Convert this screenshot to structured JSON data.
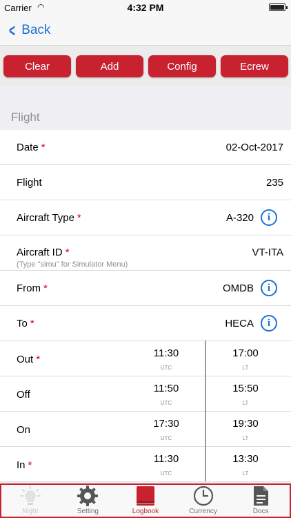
{
  "status": {
    "carrier": "Carrier",
    "time": "4:32 PM"
  },
  "nav": {
    "back_label": "Back"
  },
  "toolbar": {
    "clear": "Clear",
    "add": "Add",
    "config": "Config",
    "ecrew": "Ecrew"
  },
  "section": {
    "title": "Flight"
  },
  "fields": {
    "date": {
      "label": "Date",
      "value": "02-Oct-2017"
    },
    "flight": {
      "label": "Flight",
      "value": "235"
    },
    "aircraft_type": {
      "label": "Aircraft Type",
      "value": "A-320"
    },
    "aircraft_id": {
      "label": "Aircraft ID",
      "value": "VT-ITA",
      "hint": "(Type \"simu\" for Simulator Menu)"
    },
    "from": {
      "label": "From",
      "value": "OMDB"
    },
    "to": {
      "label": "To",
      "value": "HECA"
    }
  },
  "times": {
    "utc_label": "UTC",
    "lt_label": "LT",
    "out": {
      "label": "Out",
      "utc": "11:30",
      "lt": "17:00"
    },
    "off": {
      "label": "Off",
      "utc": "11:50",
      "lt": "15:50"
    },
    "on": {
      "label": "On",
      "utc": "17:30",
      "lt": "19:30"
    },
    "in": {
      "label": "In",
      "utc": "11:30",
      "lt": "13:30"
    }
  },
  "required_mark": "*",
  "tabs": [
    {
      "label": "Night",
      "icon": "bulb-icon"
    },
    {
      "label": "Setting",
      "icon": "gear-icon"
    },
    {
      "label": "Logbook",
      "icon": "book-icon"
    },
    {
      "label": "Currency",
      "icon": "clock-icon"
    },
    {
      "label": "Docs",
      "icon": "document-icon"
    }
  ],
  "colors": {
    "accent": "#c8212f",
    "link": "#1a6fd6",
    "required": "#d0021b"
  }
}
